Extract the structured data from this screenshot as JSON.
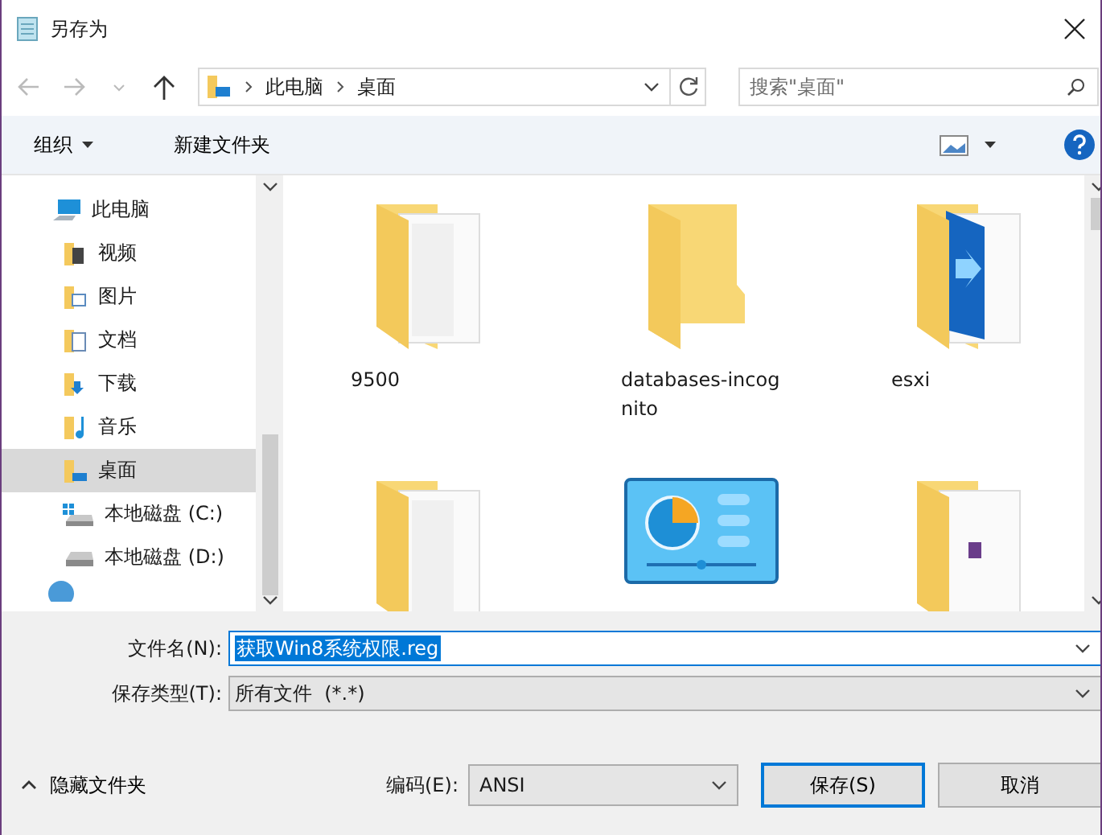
{
  "window": {
    "title": "另存为"
  },
  "address": {
    "path": [
      "此电脑",
      "桌面"
    ],
    "search_placeholder": "搜索\"桌面\""
  },
  "toolbar": {
    "organize": "组织",
    "new_folder": "新建文件夹"
  },
  "nav": [
    {
      "label": "此电脑",
      "kind": "pc",
      "selected": false,
      "children": [
        {
          "label": "视频",
          "kind": "video",
          "selected": false
        },
        {
          "label": "图片",
          "kind": "pictures",
          "selected": false
        },
        {
          "label": "文档",
          "kind": "documents",
          "selected": false
        },
        {
          "label": "下载",
          "kind": "downloads",
          "selected": false
        },
        {
          "label": "音乐",
          "kind": "music",
          "selected": false
        },
        {
          "label": "桌面",
          "kind": "desktop",
          "selected": true
        },
        {
          "label": "本地磁盘 (C:)",
          "kind": "system-drive",
          "selected": false
        },
        {
          "label": "本地磁盘 (D:)",
          "kind": "drive",
          "selected": false
        }
      ]
    }
  ],
  "files": [
    {
      "name": "9500",
      "kind": "folder-docs"
    },
    {
      "name": "databases-incognito",
      "kind": "folder-empty"
    },
    {
      "name": "esxi",
      "kind": "folder-app"
    },
    {
      "kind": "folder-docs"
    },
    {
      "kind": "control-panel"
    },
    {
      "kind": "folder-archive"
    }
  ],
  "form": {
    "filename_label": "文件名(N):",
    "filename": "获取Win8系统权限.reg",
    "type_label": "保存类型(T):",
    "type": "所有文件  (*.*)"
  },
  "footer": {
    "hide_folders": "隐藏文件夹",
    "encoding_label": "编码(E):",
    "encoding": "ANSI",
    "save": "保存(S)",
    "cancel": "取消"
  }
}
